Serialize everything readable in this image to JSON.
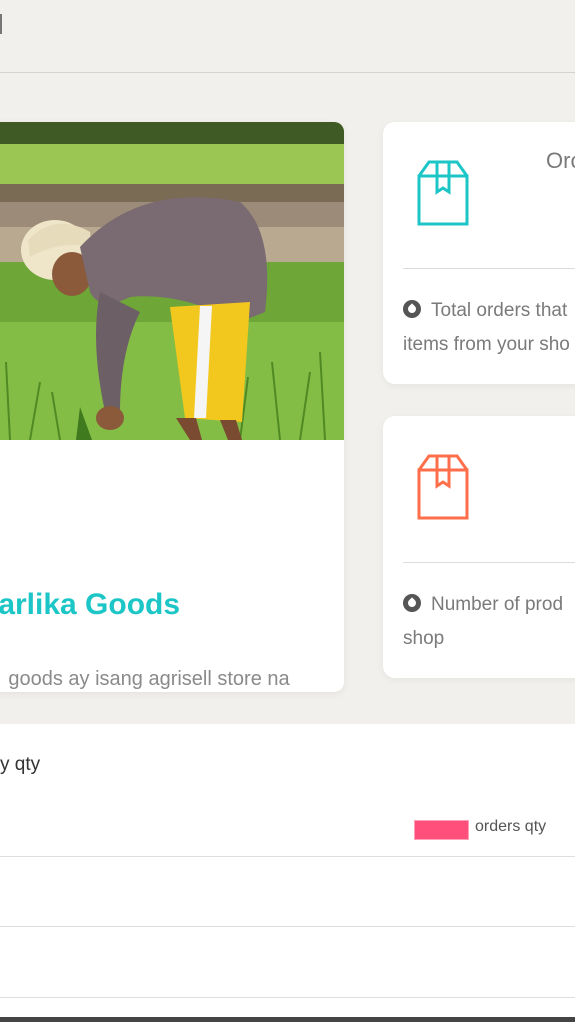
{
  "topbar": {
    "mark": "|"
  },
  "shop": {
    "name": "harlika Goods",
    "description": "goods ay isang agrisell store na nagbebenta ng sariwang gulay at prutas.",
    "photo_alt": "Farmer planting rice seedlings in a paddy field"
  },
  "stats": {
    "orders": {
      "title": "Orc",
      "note": "Total orders that items from your sho",
      "icon": "box-icon",
      "color": "#1cc6c6"
    },
    "products": {
      "title": "",
      "note": "Number of prod shop",
      "icon": "box-icon",
      "color": "#ff6e4a"
    }
  },
  "chart_data": {
    "type": "bar",
    "title": "y qty",
    "series": [
      {
        "name": "orders qty",
        "values": []
      }
    ],
    "legend": "top-right",
    "grid": true
  },
  "colors": {
    "accent": "#1cc6c6",
    "orange": "#ff6e4a",
    "legend_pink": "#ff4f7a"
  }
}
